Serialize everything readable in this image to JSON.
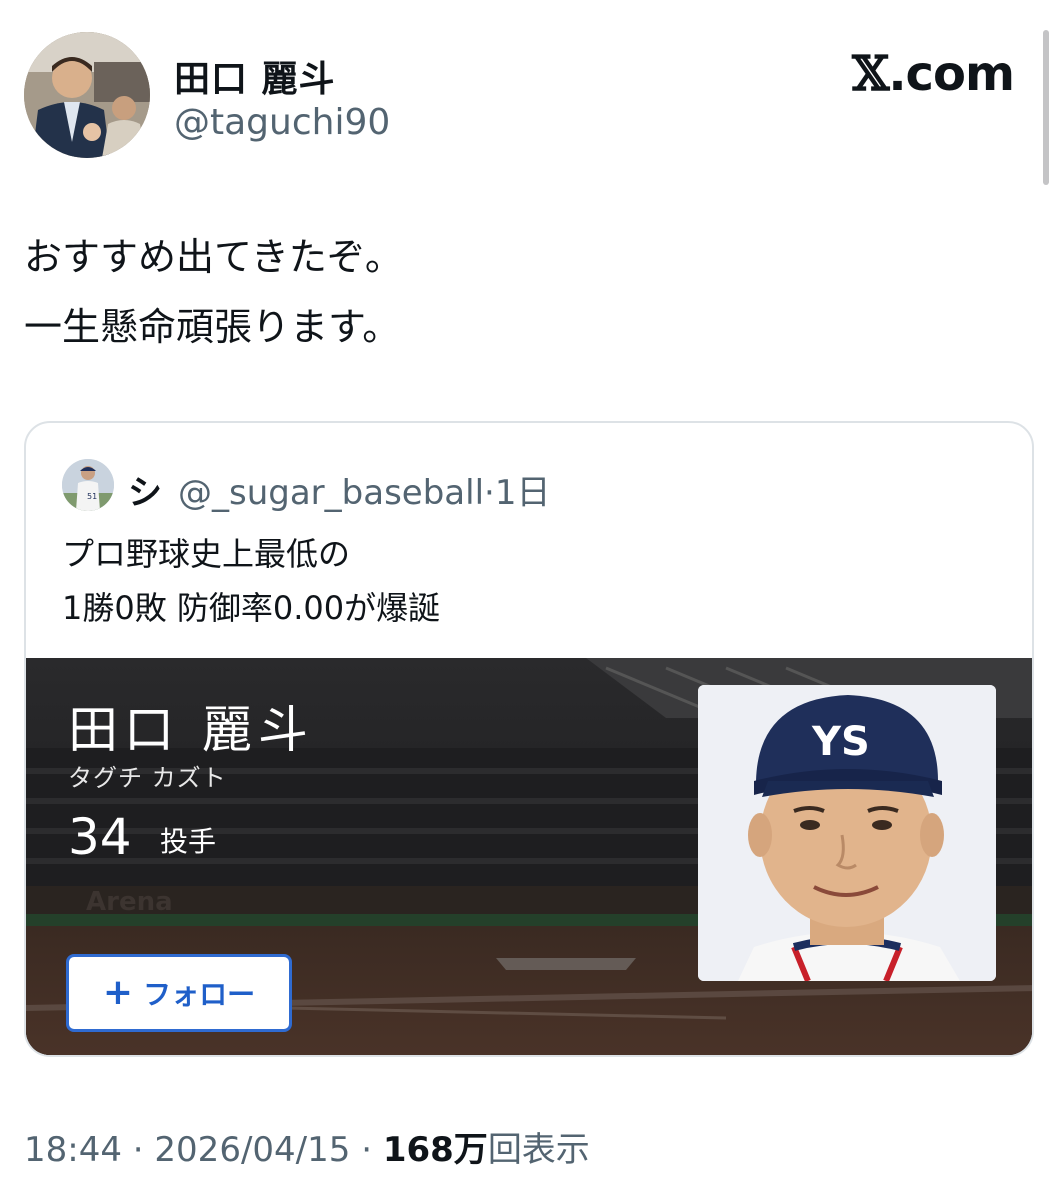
{
  "author": {
    "name": "田口 麗斗",
    "handle": "@taguchi90",
    "avatar_icon": "profile-photo"
  },
  "brand": {
    "x": "𝕏",
    "label": ".com"
  },
  "tweet": {
    "lines": [
      "おすすめ出てきたぞ。",
      "一生懸命頑張ります。"
    ]
  },
  "quote": {
    "name": "シ",
    "handle": "@_sugar_baseball",
    "separator": "·",
    "time": "1日",
    "lines": [
      "プロ野球史上最低の",
      "1勝0敗 防御率0.00が爆誕"
    ],
    "media": {
      "player_name": "田口 麗斗",
      "player_kana": "タグチ カズト",
      "player_number": "34",
      "player_position": "投手",
      "follow_label": "フォロー",
      "follow_icon": "plus-icon",
      "cap_logo": "YS"
    }
  },
  "footer": {
    "time": "18:44",
    "sep1": " · ",
    "date": "2026/04/15",
    "sep2": " · ",
    "views_count": "168万",
    "views_label": "回表示"
  },
  "colors": {
    "text": "#0f1419",
    "muted": "#536471",
    "follow_blue": "#1f5fc9",
    "card_border": "#dde2e6"
  }
}
